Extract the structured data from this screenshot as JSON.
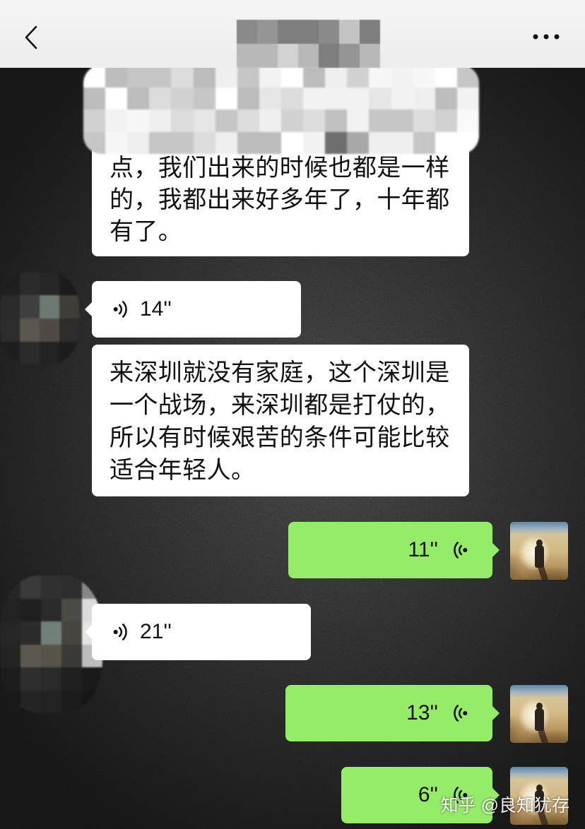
{
  "header": {
    "back_icon": "chevron-left-icon",
    "more_icon": "more-dots-icon"
  },
  "colors": {
    "header_bg": "#ededed",
    "chat_bg": "#2a2a2a",
    "incoming_bubble": "#ffffff",
    "outgoing_bubble": "#95ec69",
    "message_text": "#111111"
  },
  "messages": [
    {
      "outgoing": false,
      "text_lines": [
        "点，我们出来的时候也都是一样",
        "的，我都出来好多年了，十年都",
        "有了。"
      ]
    },
    {
      "outgoing": false,
      "voice_duration": "14''",
      "icon": "voice-icon"
    },
    {
      "outgoing": false,
      "text_lines": [
        "来深圳就没有家庭，这个深圳是",
        "一个战场，来深圳都是打仗的，",
        "所以有时候艰苦的条件可能比较",
        "适合年轻人。"
      ]
    },
    {
      "outgoing": true,
      "voice_duration": "11''",
      "icon": "voice-icon"
    },
    {
      "outgoing": false,
      "voice_duration": "21''",
      "icon": "voice-icon"
    },
    {
      "outgoing": true,
      "voice_duration": "13''",
      "icon": "voice-icon"
    },
    {
      "outgoing": true,
      "voice_duration": "6''",
      "icon": "voice-icon"
    }
  ],
  "watermark": "知乎 @良知犹存"
}
